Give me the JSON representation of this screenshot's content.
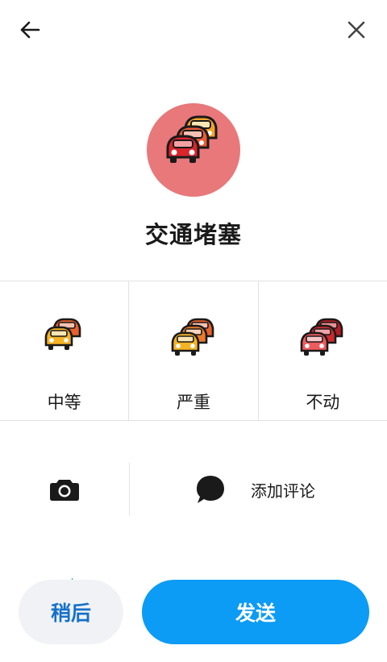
{
  "header": {
    "back_icon": "arrow-left-icon",
    "close_icon": "close-icon"
  },
  "hero": {
    "title": "交通堵塞",
    "icon": "traffic-jam-icon",
    "circle_color": "#e8787a"
  },
  "options": [
    {
      "label": "中等",
      "icon": "moderate-traffic-icon"
    },
    {
      "label": "严重",
      "icon": "heavy-traffic-icon"
    },
    {
      "label": "不动",
      "icon": "standstill-traffic-icon"
    }
  ],
  "extras": {
    "camera_icon": "camera-icon",
    "comment_icon": "comment-icon",
    "comment_label": "添加评论"
  },
  "actions": {
    "later_label": "稍后",
    "send_label": "发送",
    "accent": "#0c9bf5"
  }
}
